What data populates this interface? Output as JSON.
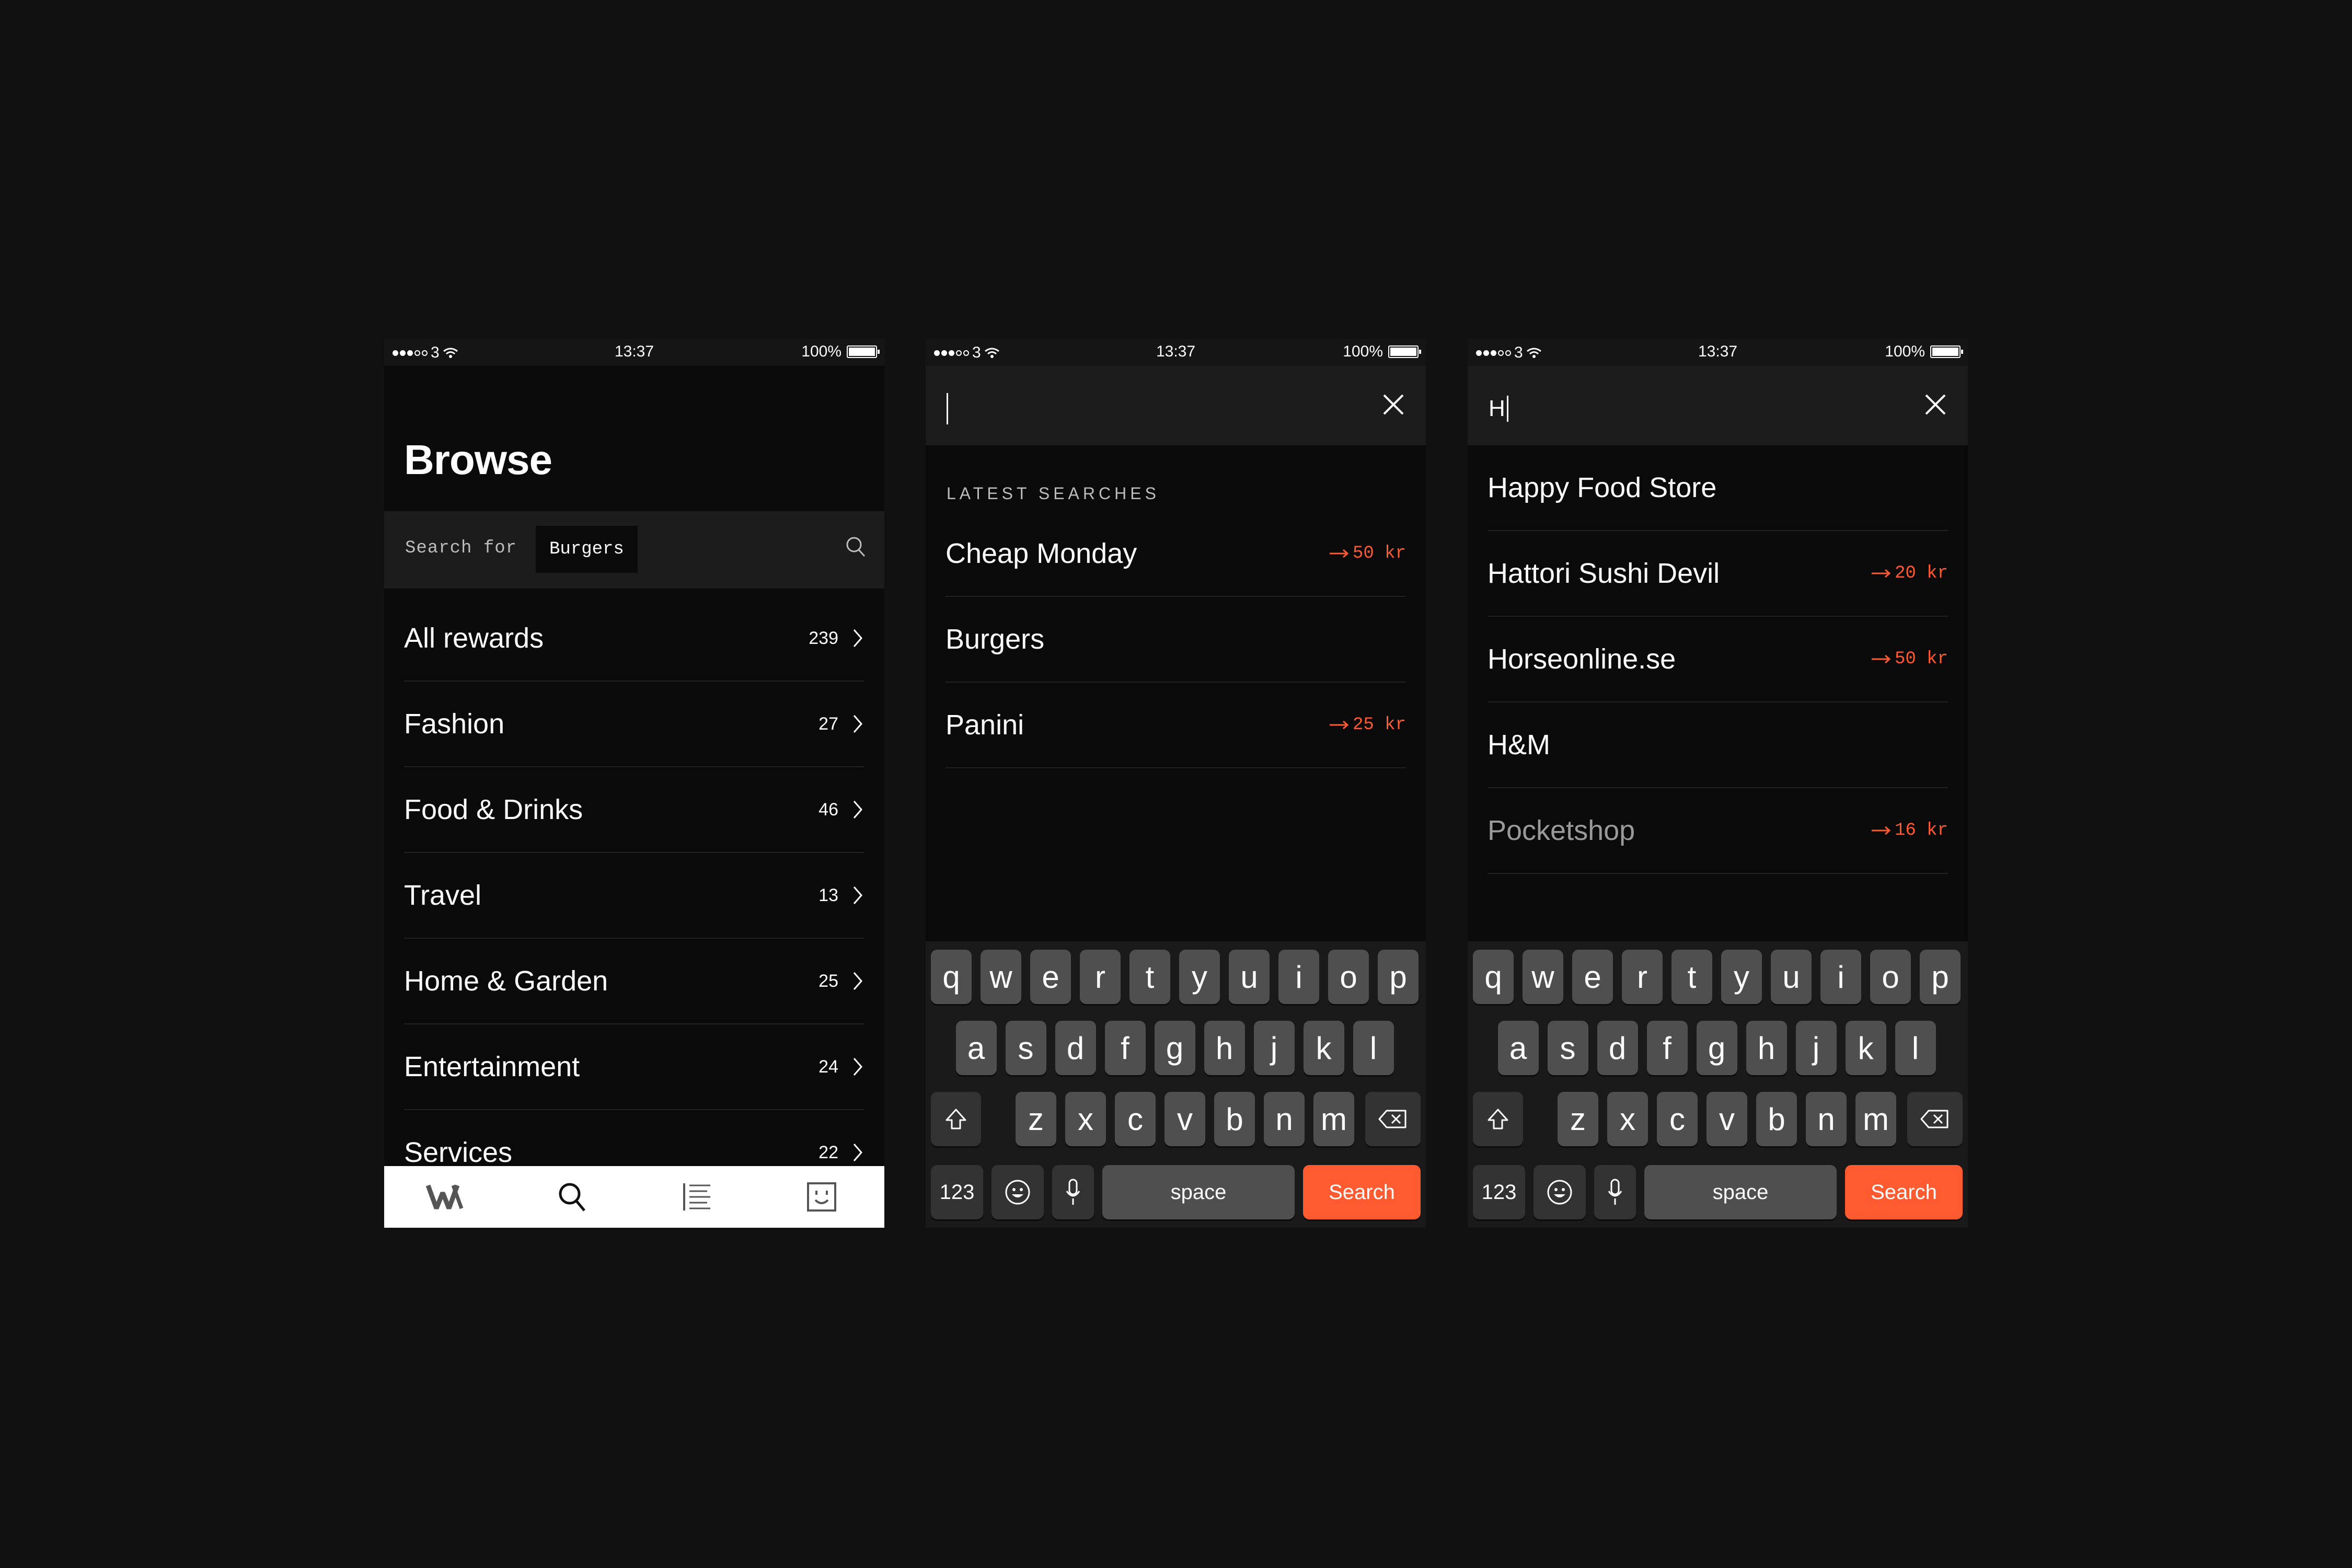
{
  "colors": {
    "background": "#111111",
    "accent": "#ff5a30",
    "screen": "#0a0a0a"
  },
  "status": {
    "carrier": "3",
    "time": "13:37",
    "battery": "100%"
  },
  "browse": {
    "title": "Browse",
    "search_prefix": "Search for",
    "search_chip": "Burgers",
    "categories": [
      {
        "label": "All rewards",
        "count": "239"
      },
      {
        "label": "Fashion",
        "count": "27"
      },
      {
        "label": "Food & Drinks",
        "count": "46"
      },
      {
        "label": "Travel",
        "count": "13"
      },
      {
        "label": "Home & Garden",
        "count": "25"
      },
      {
        "label": "Entertainment",
        "count": "24"
      },
      {
        "label": "Services",
        "count": "22"
      }
    ],
    "tabbar_icons": [
      "logo-icon",
      "search-icon",
      "list-icon",
      "profile-icon"
    ]
  },
  "latest": {
    "label": "LATEST SEARCHES",
    "items": [
      {
        "label": "Cheap Monday",
        "price": "50 kr"
      },
      {
        "label": "Burgers",
        "price": ""
      },
      {
        "label": "Panini",
        "price": "25 kr"
      }
    ]
  },
  "suggest": {
    "query": "H",
    "items": [
      {
        "prefix": "Happy Food Store",
        "rest": "",
        "price": ""
      },
      {
        "prefix": "Hattori Sushi Devil",
        "rest": "",
        "price": "20 kr"
      },
      {
        "prefix": "Horseonline.se",
        "rest": "",
        "price": "50 kr"
      },
      {
        "prefix": "H&M",
        "rest": "",
        "price": ""
      },
      {
        "prefix": "Pocketshop",
        "rest": "",
        "price": "16 kr"
      }
    ]
  },
  "keyboard": {
    "row1": [
      "q",
      "w",
      "e",
      "r",
      "t",
      "y",
      "u",
      "i",
      "o",
      "p"
    ],
    "row2": [
      "a",
      "s",
      "d",
      "f",
      "g",
      "h",
      "j",
      "k",
      "l"
    ],
    "row3": [
      "z",
      "x",
      "c",
      "v",
      "b",
      "n",
      "m"
    ],
    "numbers": "123",
    "space": "space",
    "search": "Search"
  }
}
